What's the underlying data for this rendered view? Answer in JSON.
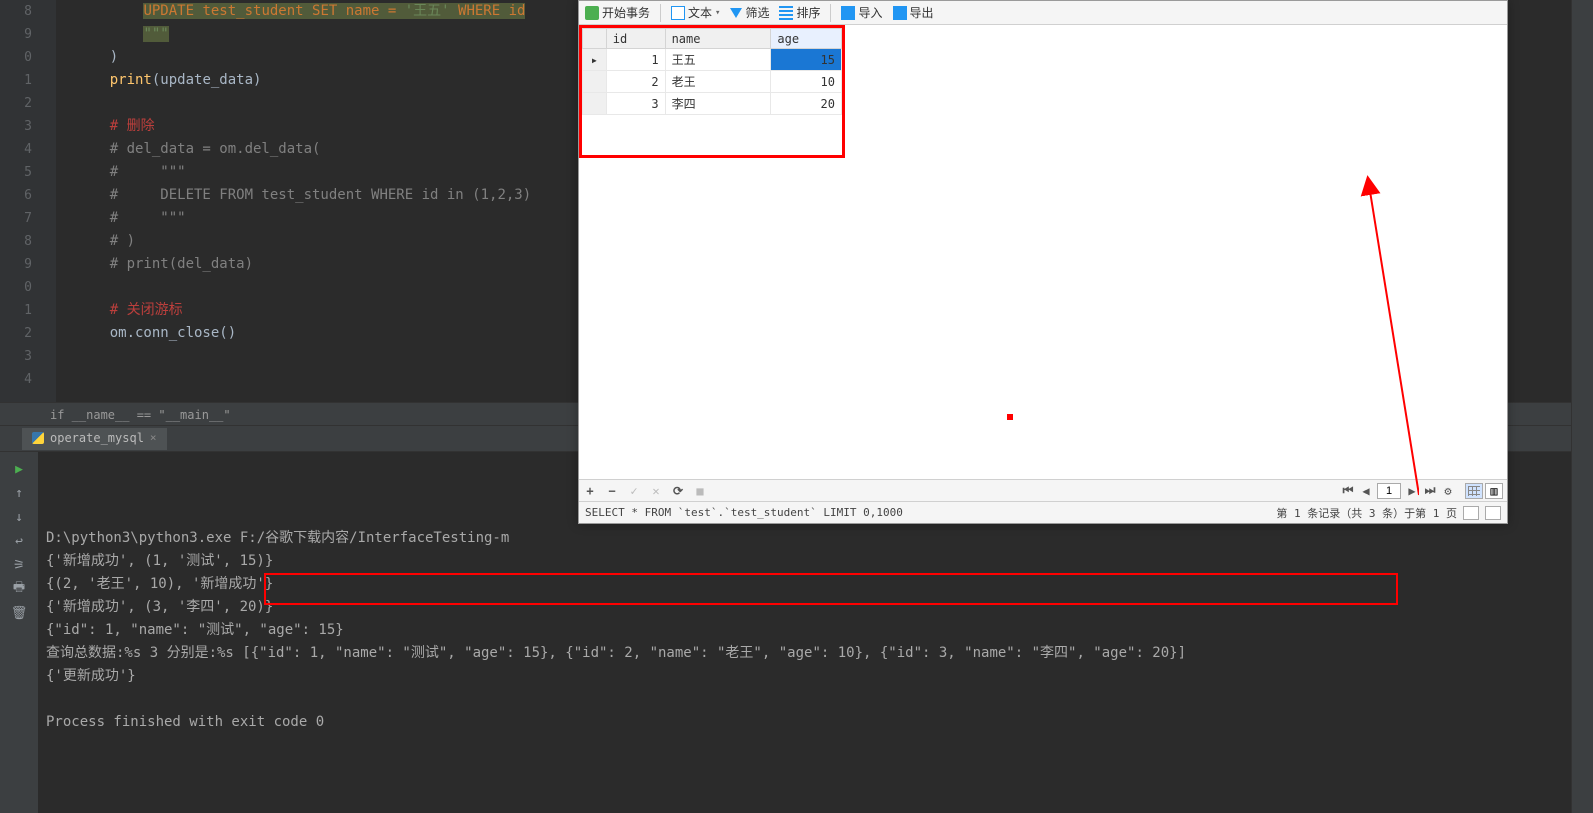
{
  "editor": {
    "lineStart": 8,
    "lines": [
      {
        "n": "8",
        "frags": [
          {
            "t": "        ",
            "c": ""
          },
          {
            "t": "UPDATE test_student SET name = ",
            "c": "kw hl"
          },
          {
            "t": "'王五'",
            "c": "str hl"
          },
          {
            "t": " WHERE id",
            "c": "kw hl"
          }
        ]
      },
      {
        "n": "9",
        "frags": [
          {
            "t": "        ",
            "c": ""
          },
          {
            "t": "\"\"\"",
            "c": "str hl"
          }
        ]
      },
      {
        "n": "0",
        "frags": [
          {
            "t": "    )",
            "c": "py"
          }
        ]
      },
      {
        "n": "1",
        "frags": [
          {
            "t": "    ",
            "c": ""
          },
          {
            "t": "print",
            "c": "fn"
          },
          {
            "t": "(update_data)",
            "c": "py"
          }
        ]
      },
      {
        "n": "2",
        "frags": [
          {
            "t": "",
            "c": ""
          }
        ]
      },
      {
        "n": "3",
        "frags": [
          {
            "t": "    ",
            "c": ""
          },
          {
            "t": "# 删除",
            "c": "red"
          }
        ]
      },
      {
        "n": "4",
        "frags": [
          {
            "t": "    ",
            "c": ""
          },
          {
            "t": "# del_data = om.del_data(",
            "c": "cmt"
          }
        ]
      },
      {
        "n": "5",
        "frags": [
          {
            "t": "    ",
            "c": ""
          },
          {
            "t": "#     \"\"\"",
            "c": "cmt"
          }
        ]
      },
      {
        "n": "6",
        "frags": [
          {
            "t": "    ",
            "c": ""
          },
          {
            "t": "#     DELETE FROM test_student WHERE id in (1,2,3)",
            "c": "cmt"
          }
        ]
      },
      {
        "n": "7",
        "frags": [
          {
            "t": "    ",
            "c": ""
          },
          {
            "t": "#     \"\"\"",
            "c": "cmt"
          }
        ]
      },
      {
        "n": "8",
        "frags": [
          {
            "t": "    ",
            "c": ""
          },
          {
            "t": "# )",
            "c": "cmt"
          }
        ]
      },
      {
        "n": "9",
        "frags": [
          {
            "t": "    ",
            "c": ""
          },
          {
            "t": "# print(del_data)",
            "c": "cmt"
          }
        ]
      },
      {
        "n": "0",
        "frags": [
          {
            "t": "",
            "c": ""
          }
        ]
      },
      {
        "n": "1",
        "frags": [
          {
            "t": "    ",
            "c": ""
          },
          {
            "t": "# 关闭游标",
            "c": "red"
          }
        ]
      },
      {
        "n": "2",
        "frags": [
          {
            "t": "    om.conn_close()",
            "c": "py"
          }
        ]
      },
      {
        "n": "3",
        "frags": [
          {
            "t": "",
            "c": ""
          }
        ]
      },
      {
        "n": "4",
        "frags": [
          {
            "t": "",
            "c": ""
          }
        ]
      }
    ]
  },
  "breadcrumb": "if __name__ == \"__main__\"",
  "runTab": "operate_mysql",
  "console": {
    "lines": [
      "D:\\python3\\python3.exe F:/谷歌下载内容/InterfaceTesting-m",
      "{'新增成功', (1, '测试', 15)}",
      "{(2, '老王', 10), '新增成功'}",
      "{'新增成功', (3, '李四', 20)}",
      "{\"id\": 1, \"name\": \"测试\", \"age\": 15}",
      "查询总数据:%s 3 分别是:%s [{\"id\": 1, \"name\": \"测试\", \"age\": 15}, {\"id\": 2, \"name\": \"老王\", \"age\": 10}, {\"id\": 3, \"name\": \"李四\", \"age\": 20}]",
      "{'更新成功'}",
      "",
      "Process finished with exit code 0"
    ]
  },
  "db": {
    "toolbar": {
      "begin": "开始事务",
      "text": "文本",
      "filter": "筛选",
      "sort": "排序",
      "import": "导入",
      "export": "导出"
    },
    "columns": [
      "id",
      "name",
      "age"
    ],
    "rows": [
      {
        "id": "1",
        "name": "王五",
        "age": "15",
        "sel": true
      },
      {
        "id": "2",
        "name": "老王",
        "age": "10"
      },
      {
        "id": "3",
        "name": "李四",
        "age": "20"
      }
    ],
    "footerNav": {
      "page": "1"
    },
    "sql": "SELECT * FROM `test`.`test_student` LIMIT 0,1000",
    "status": "第 1 条记录（共 3 条）于第 1 页"
  },
  "icons": {
    "plus": "+",
    "minus": "−",
    "check": "✓",
    "x": "✕",
    "refresh": "⟳",
    "stop": "■",
    "first": "⏮",
    "prev": "◀",
    "next": "▶",
    "last": "⏭",
    "gear": "⚙",
    "play": "▶",
    "up": "↑",
    "down": "↓",
    "wrap": "↩",
    "filterC": "⚞",
    "print": "🖶",
    "trash": "🗑",
    "rt": "▶"
  }
}
